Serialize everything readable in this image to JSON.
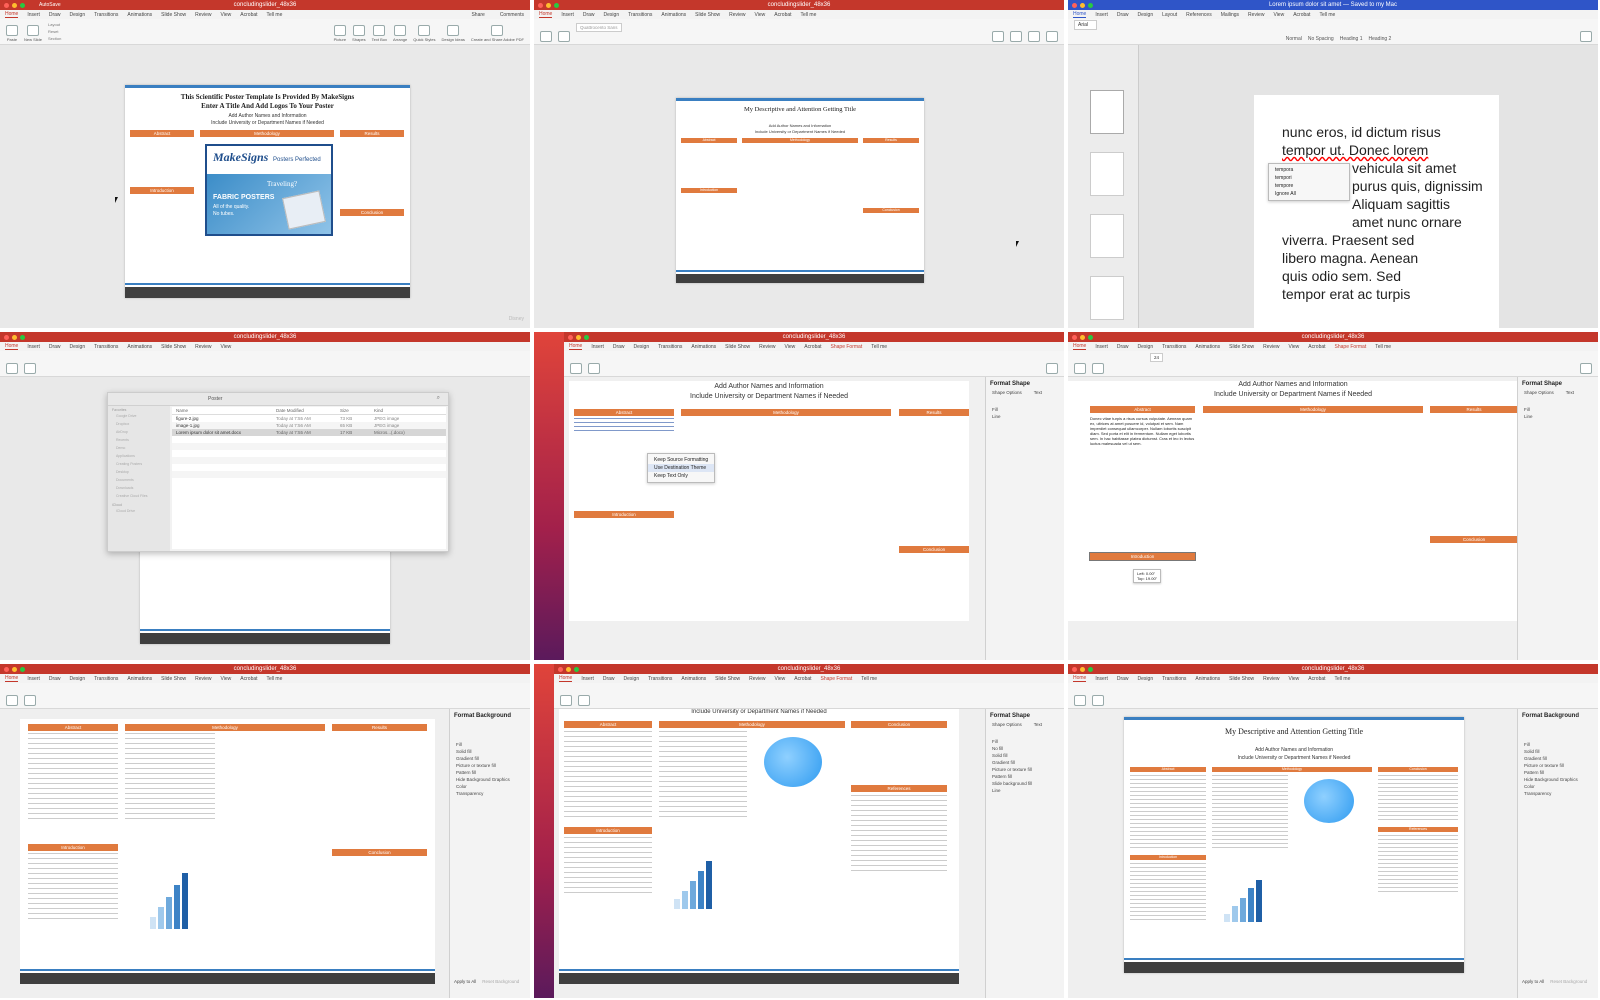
{
  "panels": {
    "p1": {
      "window_title": "concludingslider_48x36",
      "autosave": "AutoSave",
      "tabs": [
        "Home",
        "Insert",
        "Draw",
        "Design",
        "Transitions",
        "Animations",
        "Slide Show",
        "Review",
        "View",
        "Acrobat",
        "Tell me"
      ],
      "share": "Share",
      "comments": "Comments",
      "ribbon": [
        "Paste",
        "New Slide",
        "Layout",
        "Reset",
        "Section",
        "Picture",
        "Shapes",
        "Text Box",
        "Arrange",
        "Quick Styles",
        "Design Ideas",
        "Create and Share Adobe PDF"
      ],
      "slide_title_line1": "This Scientific Poster Template Is Provided By MakeSigns",
      "slide_title_line2": "Enter A Title And Add Logos To Your Poster",
      "slide_sub1": "Add Author Names and Information",
      "slide_sub2": "Include University or Department Names if Needed",
      "headers": [
        "Abstract",
        "Methodology",
        "Results",
        "Conclusion",
        "Introduction"
      ],
      "ad_brand": "MakeSigns",
      "ad_tag": "Posters Perfected",
      "ad_traveling": "Traveling?",
      "ad_fabric": "FABRIC POSTERS",
      "ad_fabric_sub": "All of the quality.",
      "ad_fabric_sub2": "No tubes.",
      "watermark": "Disney"
    },
    "p2": {
      "window_title": "concludingslider_48x36",
      "tabs": [
        "Home",
        "Insert",
        "Draw",
        "Design",
        "Transitions",
        "Animations",
        "Slide Show",
        "Review",
        "View",
        "Acrobat",
        "Tell me"
      ],
      "font_box": "Quattrocento Sans",
      "slide_title": "My Descriptive and Attention Getting Title",
      "slide_sub1": "Add Author Names and Information",
      "slide_sub2": "Include University or Department Names if Needed",
      "headers": [
        "Abstract",
        "Methodology",
        "Results",
        "Introduction",
        "Conclusion"
      ]
    },
    "p3": {
      "window_title": "Lorem ipsum dolor sit amet — Saved to my Mac",
      "tabs": [
        "Home",
        "Insert",
        "Draw",
        "Design",
        "Layout",
        "References",
        "Mailings",
        "Review",
        "View",
        "Acrobat",
        "Tell me"
      ],
      "font": "Arial",
      "styles": [
        "Normal",
        "No Spacing",
        "Heading 1",
        "Heading 2"
      ],
      "doc_lines": [
        "nunc eros, id dictum risus",
        "tempor ut. Donec lorem",
        "vehicula sit amet",
        "purus quis, dignissim",
        "Aliquam sagittis",
        "amet nunc ornare",
        "viverra. Praesent sed",
        "libero magna. Aenean",
        "quis odio sem. Sed",
        "tempor erat ac turpis"
      ],
      "suggestions": [
        "tempora",
        "tempori",
        "tempore",
        "Ignore All"
      ]
    },
    "p4": {
      "window_title": "concludingslider_48x36",
      "tabs": [
        "Home",
        "Insert",
        "Draw",
        "Design",
        "Transitions",
        "Animations",
        "Slide Show",
        "Review",
        "View",
        "Acrobat",
        "Tell me"
      ],
      "finder_title": "Poster",
      "favorites_label": "Favorites",
      "sidebar": [
        "Google Drive",
        "Dropbox",
        "AirDrop",
        "Recents",
        "Demo",
        "Applications",
        "Creating Posters",
        "Desktop",
        "Documents",
        "Downloads",
        "Creative Cloud Files"
      ],
      "icloud_label": "iCloud",
      "icloud_item": "iCloud Drive",
      "columns": [
        "Name",
        "Date Modified",
        "Size",
        "Kind"
      ],
      "files": [
        {
          "name": "figure-2.jpg",
          "date": "Today at 7:55 AM",
          "size": "73 KB",
          "kind": "JPEG image"
        },
        {
          "name": "image-1.jpg",
          "date": "Today at 7:56 AM",
          "size": "65 KB",
          "kind": "JPEG image"
        },
        {
          "name": "Lorem ipsum dolor sit amet.docx",
          "date": "Today at 7:55 AM",
          "size": "17 KB",
          "kind": "Micros...(.docx)"
        }
      ]
    },
    "p5": {
      "window_title": "concludingslider_48x36",
      "tabs": [
        "Home",
        "Insert",
        "Draw",
        "Design",
        "Transitions",
        "Animations",
        "Slide Show",
        "Review",
        "View",
        "Acrobat",
        "Shape Format",
        "Tell me"
      ],
      "slide_sub1": "Add Author Names and Information",
      "slide_sub2": "Include University or Department Names if Needed",
      "headers": [
        "Abstract",
        "Methodology",
        "Results",
        "Introduction",
        "Conclusion"
      ],
      "paste_menu": [
        "Keep Source Formatting",
        "Use Destination Theme",
        "Keep Text Only"
      ],
      "pane_title": "Format Shape",
      "pane_tab": "Shape Options",
      "pane_tab2": "Text",
      "pane_items": [
        "Fill",
        "Line"
      ]
    },
    "p6": {
      "window_title": "concludingslider_48x36",
      "tabs": [
        "Home",
        "Insert",
        "Draw",
        "Design",
        "Transitions",
        "Animations",
        "Slide Show",
        "Review",
        "View",
        "Acrobat",
        "Shape Format",
        "Tell me"
      ],
      "font_size": "24",
      "slide_sub1": "Add Author Names and Information",
      "slide_sub2": "Include University or Department Names if Needed",
      "headers": [
        "Abstract",
        "Methodology",
        "Results",
        "Introduction",
        "Conclusion"
      ],
      "abstract_text": "Donec vitae turpis a risus cursus vulputate. Aenean quam ex, ultrices at amet posuere id, volutpat et sem. Nam imperdiet consequat ullamcorper. Nullam lobortis suscipit diam. Sed porta et elit in fermentum. Nullam eget lobortis sem. In hac habitasse platea dictumst. Cras et leo in lectus luctus malesuada vel ut sem.",
      "tooltip_left": "Left: 0.00\"",
      "tooltip_top": "Top: 19.00\"",
      "pane_title": "Format Shape",
      "pane_tab": "Shape Options",
      "pane_tab2": "Text",
      "pane_items": [
        "Fill",
        "Line"
      ]
    },
    "p7": {
      "window_title": "concludingslider_48x36",
      "tabs": [
        "Home",
        "Insert",
        "Draw",
        "Design",
        "Transitions",
        "Animations",
        "Slide Show",
        "Review",
        "View",
        "Acrobat",
        "Tell me"
      ],
      "headers": [
        "Abstract",
        "Methodology",
        "Results",
        "Introduction",
        "Conclusion"
      ],
      "pane_title": "Format Background",
      "pane_items": [
        "Fill",
        "Solid fill",
        "Gradient fill",
        "Picture or texture fill",
        "Pattern fill",
        "Hide Background Graphics",
        "Color",
        "Transparency"
      ],
      "apply_all": "Apply to All",
      "reset_bg": "Reset Background"
    },
    "p8": {
      "window_title": "concludingslider_48x36",
      "tabs": [
        "Home",
        "Insert",
        "Draw",
        "Design",
        "Transitions",
        "Animations",
        "Slide Show",
        "Review",
        "View",
        "Acrobat",
        "Shape Format",
        "Tell me"
      ],
      "slide_sub2": "Include University or Department Names if Needed",
      "headers": [
        "Abstract",
        "Methodology",
        "Results",
        "Conclusion",
        "Introduction",
        "References"
      ],
      "pane_title": "Format Shape",
      "pane_tab": "Shape Options",
      "pane_tab2": "Text",
      "pane_items": [
        "Fill",
        "No fill",
        "Solid fill",
        "Gradient fill",
        "Picture or texture fill",
        "Pattern fill",
        "Slide background fill",
        "Line"
      ]
    },
    "p9": {
      "window_title": "concludingslider_48x36",
      "tabs": [
        "Home",
        "Insert",
        "Draw",
        "Design",
        "Transitions",
        "Animations",
        "Slide Show",
        "Review",
        "View",
        "Acrobat",
        "Tell me"
      ],
      "slide_title": "My Descriptive and Attention Getting Title",
      "slide_sub1": "Add Author Names and Information",
      "slide_sub2": "Include University or Department Names if Needed",
      "headers": [
        "Abstract",
        "Methodology",
        "Results",
        "Conclusion",
        "Introduction",
        "References"
      ],
      "pane_title": "Format Background",
      "pane_items": [
        "Fill",
        "Solid fill",
        "Gradient fill",
        "Picture or texture fill",
        "Pattern fill",
        "Hide Background Graphics",
        "Color",
        "Transparency"
      ],
      "apply_all": "Apply to All",
      "reset_bg": "Reset Background"
    }
  },
  "colors": {
    "ppt_red": "#c4372b",
    "word_blue": "#2f55c8",
    "orange_header": "#e07a3e",
    "poster_blue": "#3a7fc1",
    "footer_dark": "#3f3f3f"
  }
}
